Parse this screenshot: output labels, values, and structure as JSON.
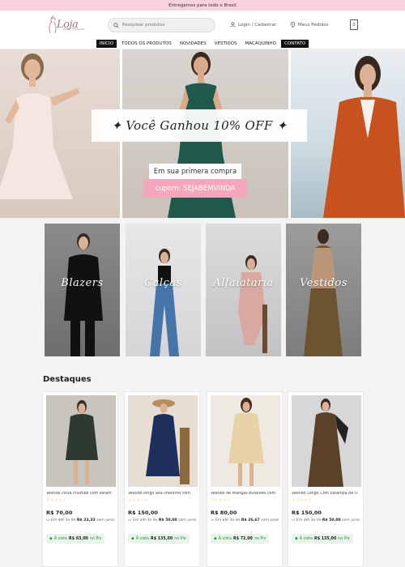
{
  "topbar": {
    "text": "Entregamos para todo o Brasil"
  },
  "header": {
    "logo_text": "Loja",
    "logo_tagline": "Moda Feminina",
    "search_placeholder": "Pesquisar produtos",
    "login_label": "Login / Cadastrar",
    "orders_label": "Meus Pedidos",
    "cart_count": "0"
  },
  "nav": {
    "items": [
      "INICIO",
      "TODOS OS PRODUTOS",
      "NOVIDADES",
      "VESTIDOS",
      "MACAQUINHO",
      "CONTATO"
    ]
  },
  "hero": {
    "title": "✦ Você Ganhou 10% OFF ✦",
    "subtitle": "Em sua primera compra",
    "coupon": "cupom: SEJABEMVINDA"
  },
  "categories": [
    "Blazers",
    "Calças",
    "Alfaiataria",
    "Vestidos"
  ],
  "section_title": "Destaques",
  "products": [
    {
      "name": "Vestido cinza chumbo com estam",
      "stars": "☆☆☆☆☆",
      "price": "R$ 70,00",
      "installment_pre": "Em até 3x de ",
      "installment_value": "R$ 23,33",
      "installment_post": " sem juros",
      "pix_pre": "À vista ",
      "pix_value": "R$ 63,00",
      "pix_post": " no Pix"
    },
    {
      "name": "Vestido longo azul marinho com",
      "stars": "☆☆☆☆☆",
      "price": "R$ 150,00",
      "installment_pre": "Em até 3x de ",
      "installment_value": "R$ 50,00",
      "installment_post": " sem juros",
      "pix_pre": "À vista ",
      "pix_value": "R$ 135,00",
      "pix_post": " no Pix"
    },
    {
      "name": "Vestido de mangas bufantes com",
      "stars": "☆☆☆☆☆",
      "price": "R$ 80,00",
      "installment_pre": "Em até 3x de ",
      "installment_value": "R$ 26,67",
      "installment_post": " sem juros",
      "pix_pre": "À vista ",
      "pix_value": "R$ 72,00",
      "pix_post": " no Pix"
    },
    {
      "name": "Vestido Longo Com Estampa de O",
      "stars": "☆☆☆☆☆",
      "price": "R$ 150,00",
      "installment_pre": "Em até 3x de ",
      "installment_value": "R$ 50,00",
      "installment_post": " sem juros",
      "pix_pre": "À vista ",
      "pix_value": "R$ 135,00",
      "pix_post": " no Pix"
    }
  ],
  "colors": {
    "topbar": "#f7d2dc",
    "coupon": "#f6a6bb",
    "pix_green": "#2e8b46",
    "stars": "#d9b24a"
  }
}
